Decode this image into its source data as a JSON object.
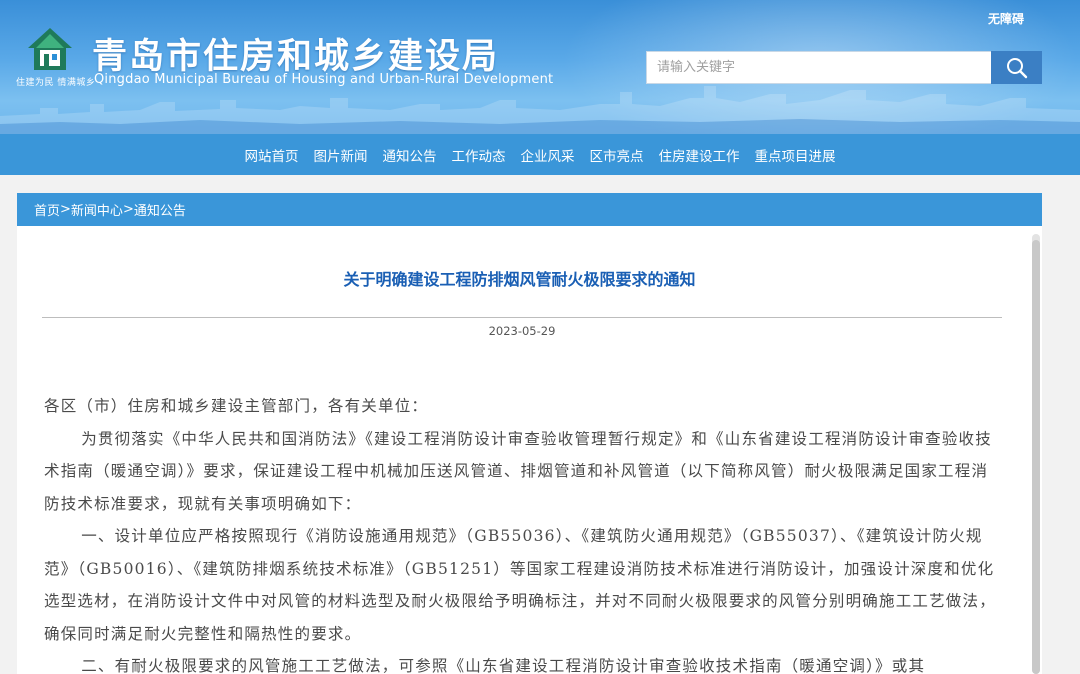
{
  "header": {
    "site_title": "青岛市住房和城乡建设局",
    "site_subtitle": "Qingdao Municipal Bureau of Housing and Urban-Rural Development",
    "logo_slogan": "住建为民 情满城乡",
    "accessibility_label": "无障碍",
    "search_placeholder": "请输入关键字"
  },
  "nav": {
    "items": [
      {
        "label": "网站首页"
      },
      {
        "label": "图片新闻"
      },
      {
        "label": "通知公告"
      },
      {
        "label": "工作动态"
      },
      {
        "label": "企业风采"
      },
      {
        "label": "区市亮点"
      },
      {
        "label": "住房建设工作"
      },
      {
        "label": "重点项目进展"
      }
    ]
  },
  "breadcrumb": {
    "home": "首页",
    "section": "新闻中心",
    "current": "通知公告",
    "separator": ">"
  },
  "article": {
    "title": "关于明确建设工程防排烟风管耐火极限要求的通知",
    "date": "2023-05-29",
    "paragraphs": [
      "各区（市）住房和城乡建设主管部门，各有关单位：",
      "为贯彻落实《中华人民共和国消防法》《建设工程消防设计审查验收管理暂行规定》和《山东省建设工程消防设计审查验收技术指南（暖通空调）》要求，保证建设工程中机械加压送风管道、排烟管道和补风管道（以下简称风管）耐火极限满足国家工程消防技术标准要求，现就有关事项明确如下：",
      "一、设计单位应严格按照现行《消防设施通用规范》（GB55036）、《建筑防火通用规范》（GB55037）、《建筑设计防火规范》（GB50016）、《建筑防排烟系统技术标准》（GB51251）等国家工程建设消防技术标准进行消防设计，加强设计深度和优化选型选材，在消防设计文件中对风管的材料选型及耐火极限给予明确标注，并对不同耐火极限要求的风管分别明确施工工艺做法，确保同时满足耐火完整性和隔热性的要求。",
      "二、有耐火极限要求的风管施工工艺做法，可参照《山东省建设工程消防设计审查验收技术指南（暖通空调）》或其"
    ]
  },
  "colors": {
    "banner_top": "#3a8fd8",
    "nav_bg": "#3a96d9",
    "title_blue": "#1a5fb4",
    "search_button": "#3b7fc4"
  }
}
